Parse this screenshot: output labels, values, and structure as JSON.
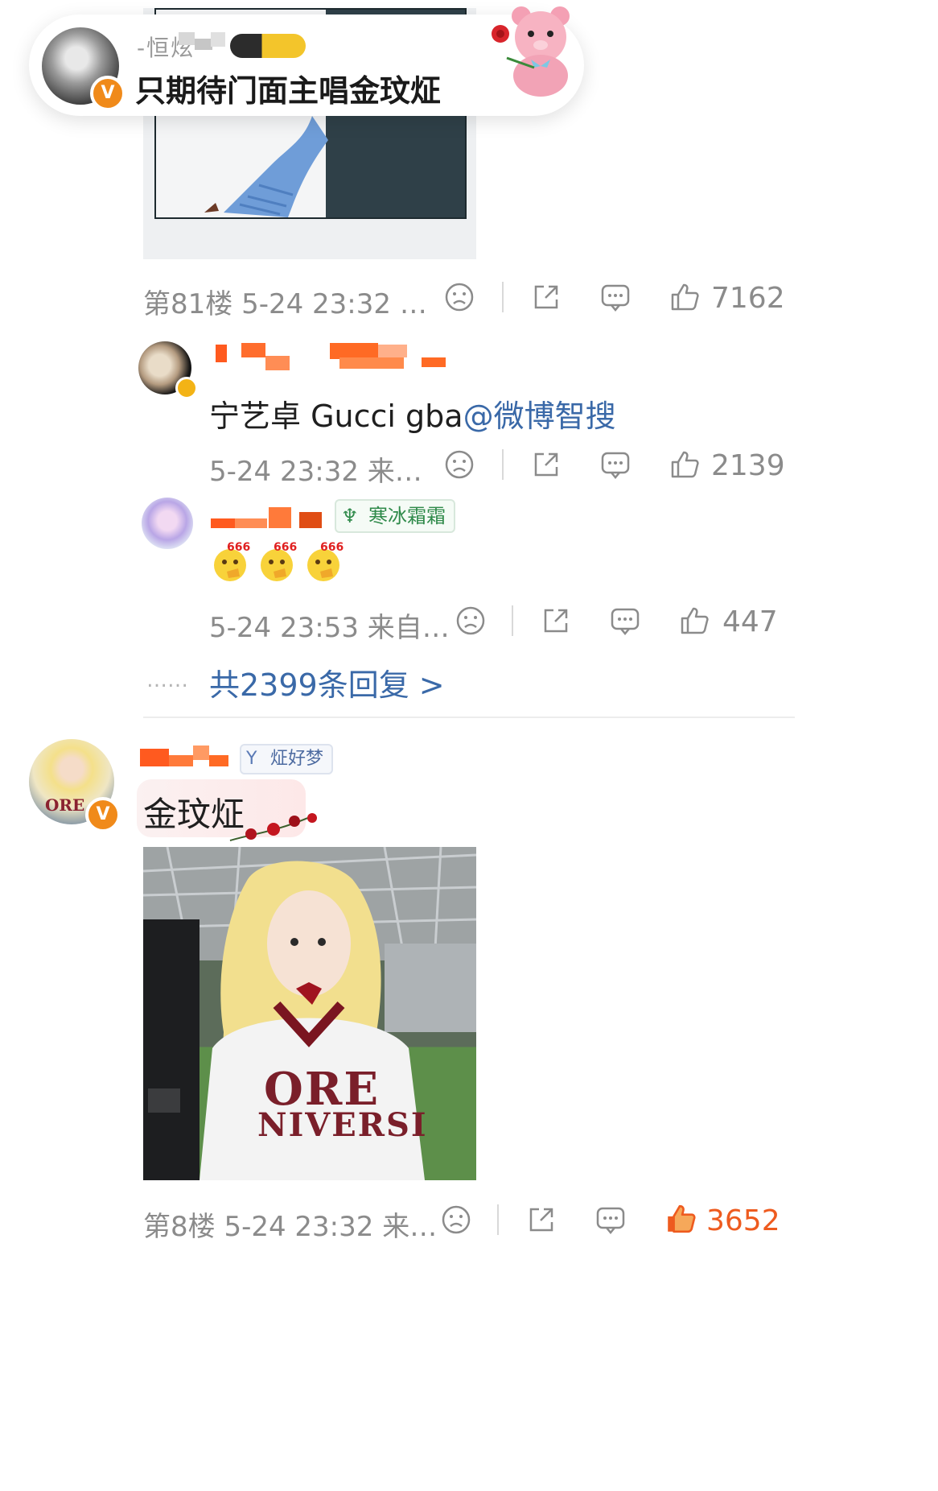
{
  "top_banner": {
    "username": "-恒炫",
    "comment": "只期待门面主唱金玟炡",
    "avatar_badge": "V"
  },
  "comment_81": {
    "floor_label": "第81楼 5-24 23:32 …",
    "likes": "7162"
  },
  "reply_1": {
    "text_plain": "宁艺卓 Gucci gba",
    "text_link": "@微博智搜",
    "meta": "5-24 23:32 来…",
    "likes": "2139"
  },
  "reply_2": {
    "fan_badge_label": "寒冰霜霜",
    "emoji_label": "666",
    "meta": "5-24 23:53 来自…",
    "likes": "447"
  },
  "more_replies": {
    "dots": "……",
    "label": "共2399条回复 >"
  },
  "comment_8": {
    "fan_badge_label": "炡好梦",
    "text": "金玟炡",
    "image_caption_top": "ORE",
    "image_caption_bottom": "NIVERSI",
    "floor_label": "第8楼 5-24 23:32 来…",
    "likes": "3652",
    "avatar_badge": "V"
  },
  "colors": {
    "meta_gray": "#8b8b8b",
    "link_blue": "#3a69a8",
    "like_active": "#ee5b1f",
    "verified_orange": "#f08a1a"
  },
  "icons": [
    "sad-face-icon",
    "share-icon",
    "comment-icon",
    "thumbs-up-icon"
  ]
}
